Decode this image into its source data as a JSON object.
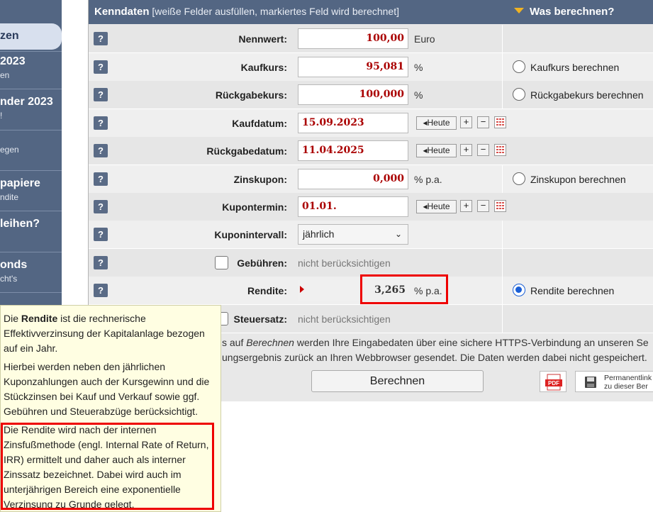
{
  "sidebar": {
    "active_label": "zen",
    "items": [
      {
        "title": "2023",
        "sub": "en"
      },
      {
        "title": "nder 2023",
        "sub": "!"
      },
      {
        "title": "",
        "sub": "egen"
      },
      {
        "title": "papiere",
        "sub": "ndite"
      },
      {
        "title": "leihen?",
        "sub": ""
      },
      {
        "title": "onds",
        "sub": "cht's"
      }
    ]
  },
  "header": {
    "title": "Kenndaten",
    "hint": " [weiße Felder ausfüllen, markiertes Feld wird berechnet]",
    "right_label": "Was berechnen?"
  },
  "help_symbol": "?",
  "rows": {
    "nennwert": {
      "label": "Nennwert:",
      "value": "100,00",
      "unit": "Euro"
    },
    "kaufkurs": {
      "label": "Kaufkurs:",
      "value": "95,081",
      "unit": "%",
      "radio": "Kaufkurs berechnen"
    },
    "rueckgabekurs": {
      "label": "Rückgabekurs:",
      "value": "100,000",
      "unit": "%",
      "radio": "Rückgabekurs berechnen"
    },
    "kaufdatum": {
      "label": "Kaufdatum:",
      "value": "15.09.2023"
    },
    "rueckgabedatum": {
      "label": "Rückgabedatum:",
      "value": "11.04.2025"
    },
    "zinskupon": {
      "label": "Zinskupon:",
      "value": "0,000",
      "unit": "% p.a.",
      "radio": "Zinskupon berechnen"
    },
    "kupontermin": {
      "label": "Kupontermin:",
      "value": "01.01."
    },
    "kuponintervall": {
      "label": "Kuponintervall:",
      "value": "jährlich"
    },
    "gebuehren": {
      "label": "Gebühren:",
      "value": "nicht berücksichtigen"
    },
    "rendite": {
      "label": "Rendite:",
      "value": "3,265",
      "unit": "% p.a.",
      "radio": "Rendite berechnen"
    },
    "steuersatz": {
      "label": "Steuersatz:",
      "value": "nicht berücksichtigen"
    }
  },
  "date_buttons": {
    "heute": "Heute",
    "plus": "+",
    "minus": "−"
  },
  "info": {
    "line1_pre": "s auf ",
    "line1_em": "Berechnen",
    "line1_post": " werden Ihre Eingabedaten über eine sichere HTTPS-Verbindung an unseren Se",
    "line2": "ungsergebnis zurück an Ihren Webbrowser gesendet. Die Daten werden dabei nicht gespeichert."
  },
  "buttons": {
    "calculate": "Berechnen",
    "pdf": "PDF",
    "permalink_line1": "Permanentlink",
    "permalink_line2": "zu dieser Ber"
  },
  "tooltip": {
    "p1_pre": "Die ",
    "p1_bold": "Rendite",
    "p1_post": " ist die rechnerische Effektivverzinsung der Kapitalanlage bezogen auf ein Jahr.",
    "p2": "Hierbei werden neben den jährlichen Kuponzahlungen auch der Kursgewinn und die Stückzinsen bei Kauf und Verkauf sowie ggf. Gebühren und Steuerabzüge berücksichtigt.",
    "p3": "Die Rendite wird nach der internen Zinsfußmethode (engl. Internal Rate of Return, IRR) ermittelt und daher auch als interner Zinssatz bezeichnet. Dabei wird auch im unterjährigen Bereich eine exponentielle Verzinsung zu Grunde gelegt."
  },
  "colors": {
    "header_bg": "#536683",
    "accent_triangle": "#f0b323",
    "value_red": "#aa0000",
    "highlight_red": "#ee0000",
    "radio_blue": "#1a5fd6"
  }
}
